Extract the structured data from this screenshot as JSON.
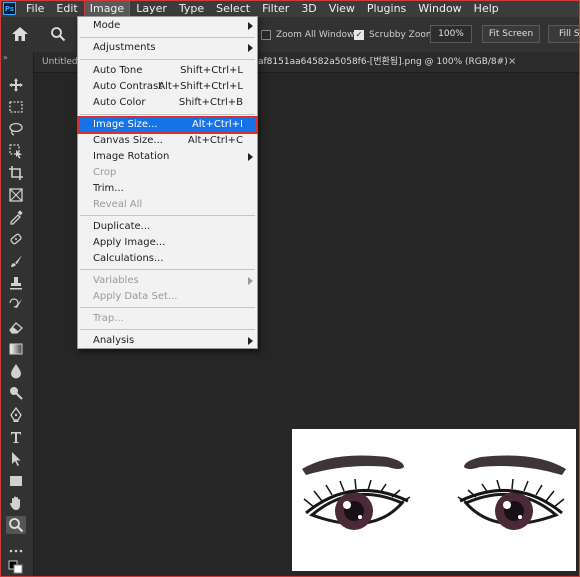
{
  "app": {
    "logo": "Ps"
  },
  "menubar": {
    "items": [
      "File",
      "Edit",
      "Image",
      "Layer",
      "Type",
      "Select",
      "Filter",
      "3D",
      "View",
      "Plugins",
      "Window",
      "Help"
    ],
    "active_item": "Image"
  },
  "options": {
    "zoom_all_windows": {
      "label": "Zoom All Windows",
      "checked": false
    },
    "scrubby_zoom": {
      "label": "Scrubby Zoom",
      "checked": true
    },
    "zoom_value": "100%",
    "fit_screen_label": "Fit Screen",
    "fill_screen_label": "Fill Sc"
  },
  "tabs": {
    "first_partial": "Untitled",
    "document": "af8151aa64582a5058f6-[번환됨].png @ 100% (RGB/8#)",
    "close": "×"
  },
  "image_menu": {
    "mode": {
      "label": "Mode"
    },
    "adjustments": {
      "label": "Adjustments"
    },
    "auto_tone": {
      "label": "Auto Tone",
      "shortcut": "Shift+Ctrl+L"
    },
    "auto_contrast": {
      "label": "Auto Contrast",
      "shortcut": "Alt+Shift+Ctrl+L"
    },
    "auto_color": {
      "label": "Auto Color",
      "shortcut": "Shift+Ctrl+B"
    },
    "image_size": {
      "label": "Image Size...",
      "shortcut": "Alt+Ctrl+I",
      "highlighted": true
    },
    "canvas_size": {
      "label": "Canvas Size...",
      "shortcut": "Alt+Ctrl+C"
    },
    "image_rotation": {
      "label": "Image Rotation"
    },
    "crop": {
      "label": "Crop",
      "disabled": true
    },
    "trim": {
      "label": "Trim..."
    },
    "reveal_all": {
      "label": "Reveal All",
      "disabled": true
    },
    "duplicate": {
      "label": "Duplicate..."
    },
    "apply_image": {
      "label": "Apply Image..."
    },
    "calculations": {
      "label": "Calculations..."
    },
    "variables": {
      "label": "Variables",
      "disabled": true
    },
    "apply_data_set": {
      "label": "Apply Data Set...",
      "disabled": true
    },
    "trap": {
      "label": "Trap...",
      "disabled": true
    },
    "analysis": {
      "label": "Analysis"
    }
  },
  "colors": {
    "highlight": "#1473e6",
    "annotation_red": "#d93030",
    "menubar_bg": "#3c3c3c",
    "canvas_bg": "#262626"
  }
}
